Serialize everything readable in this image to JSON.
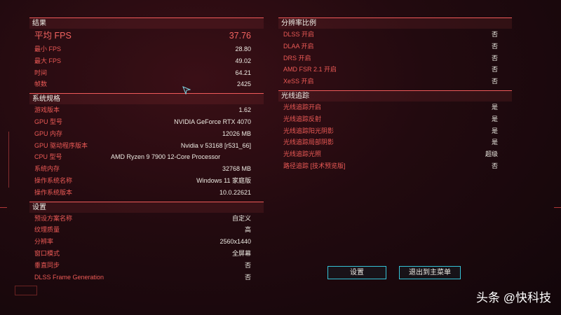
{
  "results": {
    "title": "结果",
    "avg_fps_label": "平均 FPS",
    "avg_fps_value": "37.76",
    "rows": [
      {
        "label": "最小 FPS",
        "value": "28.80"
      },
      {
        "label": "最大 FPS",
        "value": "49.02"
      },
      {
        "label": "时间",
        "value": "64.21"
      },
      {
        "label": "帧数",
        "value": "2425"
      }
    ]
  },
  "system": {
    "title": "系统规格",
    "rows": [
      {
        "label": "游戏版本",
        "value": "1.62",
        "align": "right"
      },
      {
        "label": "GPU 型号",
        "value": "NVIDIA GeForce RTX 4070",
        "align": "right"
      },
      {
        "label": "GPU 内存",
        "value": "12026 MB",
        "align": "right"
      },
      {
        "label": "GPU 驱动程序版本",
        "value": "Nvidia v 53168 [r531_66]",
        "align": "right"
      },
      {
        "label": "CPU 型号",
        "value": "AMD Ryzen 9 7900 12-Core Processor",
        "align": "mid"
      },
      {
        "label": "系统内存",
        "value": "32768 MB",
        "align": "right"
      },
      {
        "label": "操作系统名称",
        "value": "Windows 11 家庭版",
        "align": "right"
      },
      {
        "label": "操作系统版本",
        "value": "10.0.22621",
        "align": "right"
      }
    ]
  },
  "settings": {
    "title": "设置",
    "rows": [
      {
        "label": "预设方案名称",
        "value": "自定义"
      },
      {
        "label": "纹理质量",
        "value": "高"
      },
      {
        "label": "分辨率",
        "value": "2560x1440"
      },
      {
        "label": "窗口模式",
        "value": "全屏幕"
      },
      {
        "label": "垂直同步",
        "value": "否"
      },
      {
        "label": "DLSS Frame Generation",
        "value": "否"
      }
    ]
  },
  "resolution_scaling": {
    "title": "分辨率比例",
    "rows": [
      {
        "label": "DLSS 开启",
        "value": "否"
      },
      {
        "label": "DLAA 开启",
        "value": "否"
      },
      {
        "label": "DRS 开启",
        "value": "否"
      },
      {
        "label": "AMD FSR 2.1 开启",
        "value": "否"
      },
      {
        "label": "XeSS 开启",
        "value": "否"
      }
    ]
  },
  "ray_tracing": {
    "title": "光线追踪",
    "rows": [
      {
        "label": "光线追踪开启",
        "value": "是"
      },
      {
        "label": "光线追踪反射",
        "value": "是"
      },
      {
        "label": "光线追踪阳光阴影",
        "value": "是"
      },
      {
        "label": "光线追踪局部阴影",
        "value": "是"
      },
      {
        "label": "光线追踪光照",
        "value": "超级"
      },
      {
        "label": "路径追踪 [技术预览版]",
        "value": "否"
      }
    ]
  },
  "buttons": {
    "settings": "设置",
    "exit": "退出到主菜单"
  },
  "watermark": "头条 @快科技",
  "colors": {
    "accent_red": "#ec5a56",
    "button_border": "#35c3d6"
  }
}
